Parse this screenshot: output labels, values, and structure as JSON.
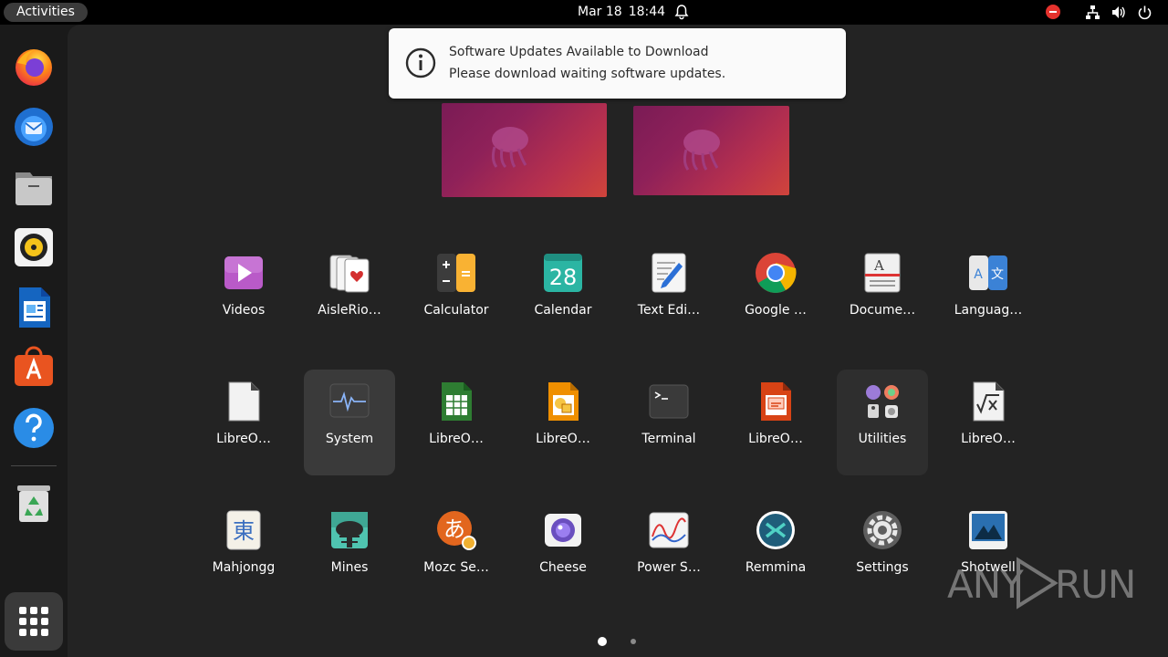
{
  "topbar": {
    "activities_label": "Activities",
    "date": "Mar 18",
    "time": "18:44",
    "icons": [
      "bell-icon",
      "stop-indicator-icon",
      "network-icon",
      "volume-icon",
      "power-icon"
    ]
  },
  "dock": {
    "items": [
      "firefox-icon",
      "thunderbird-icon",
      "files-icon",
      "rhythmbox-icon",
      "libreoffice-writer-icon",
      "app-center-icon",
      "help-icon",
      "trash-icon"
    ],
    "show_apps_icon": "show-apps-grid-icon"
  },
  "notification": {
    "title": "Software Updates Available to Download",
    "body": "Please download waiting software updates.",
    "icon": "info-icon"
  },
  "workspaces": [
    "workspace-1",
    "workspace-2"
  ],
  "apps": {
    "row1": [
      {
        "label": "Videos",
        "icon": "videos-icon"
      },
      {
        "label": "AisleRio…",
        "icon": "aisleriot-icon"
      },
      {
        "label": "Calculator",
        "icon": "calculator-icon"
      },
      {
        "label": "Calendar",
        "icon": "calendar-icon",
        "day": "28"
      },
      {
        "label": "Text Edi…",
        "icon": "text-editor-icon"
      },
      {
        "label": "Google …",
        "icon": "chrome-icon"
      },
      {
        "label": "Docume…",
        "icon": "document-viewer-icon"
      },
      {
        "label": "Languag…",
        "icon": "language-icon"
      }
    ],
    "row2": [
      {
        "label": "LibreO…",
        "icon": "libreoffice-icon"
      },
      {
        "label": "System",
        "icon": "system-monitor-icon"
      },
      {
        "label": "LibreO…",
        "icon": "libreoffice-calc-icon"
      },
      {
        "label": "LibreO…",
        "icon": "libreoffice-draw-icon"
      },
      {
        "label": "Terminal",
        "icon": "terminal-icon"
      },
      {
        "label": "LibreO…",
        "icon": "libreoffice-impress-icon"
      },
      {
        "label": "Utilities",
        "icon": "utilities-folder-icon"
      },
      {
        "label": "LibreO…",
        "icon": "libreoffice-math-icon"
      }
    ],
    "row3": [
      {
        "label": "Mahjongg",
        "icon": "mahjongg-icon",
        "glyph": "東"
      },
      {
        "label": "Mines",
        "icon": "mines-icon"
      },
      {
        "label": "Mozc Se…",
        "icon": "mozc-icon",
        "glyph": "あ"
      },
      {
        "label": "Cheese",
        "icon": "cheese-icon"
      },
      {
        "label": "Power S…",
        "icon": "power-statistics-icon"
      },
      {
        "label": "Remmina",
        "icon": "remmina-icon"
      },
      {
        "label": "Settings",
        "icon": "settings-icon"
      },
      {
        "label": "Shotwell",
        "icon": "shotwell-icon"
      }
    ]
  },
  "pages": {
    "count": 2,
    "current": 1
  },
  "watermark": {
    "left": "ANY",
    "right": "RUN"
  },
  "colors": {
    "accent": "#e95420",
    "bg": "#232323",
    "panel": "#000000"
  }
}
